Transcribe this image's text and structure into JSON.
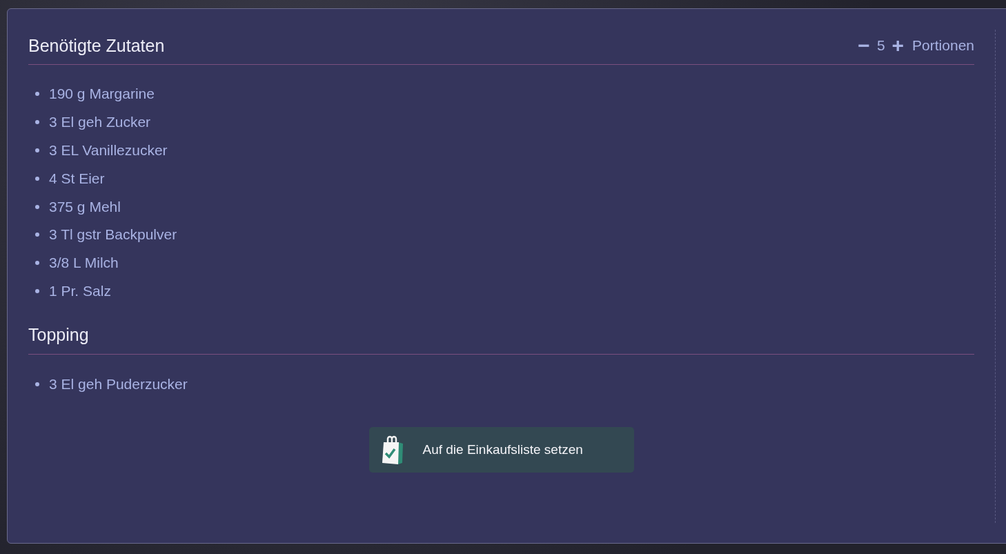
{
  "servings": {
    "minus": "−",
    "count": "5",
    "plus": "+",
    "label": "Portionen"
  },
  "sections": [
    {
      "title": "Benötigte Zutaten",
      "items": [
        "190 g Margarine",
        "3 El geh Zucker",
        "3 EL Vanillezucker",
        "4 St Eier",
        "375 g Mehl",
        "3 Tl gstr Backpulver",
        "3/8 L Milch",
        "1 Pr. Salz"
      ]
    },
    {
      "title": "Topping",
      "items": [
        "3 El geh Puderzucker"
      ]
    }
  ],
  "shopping_button": {
    "label": "Auf die Einkaufsliste setzen"
  }
}
